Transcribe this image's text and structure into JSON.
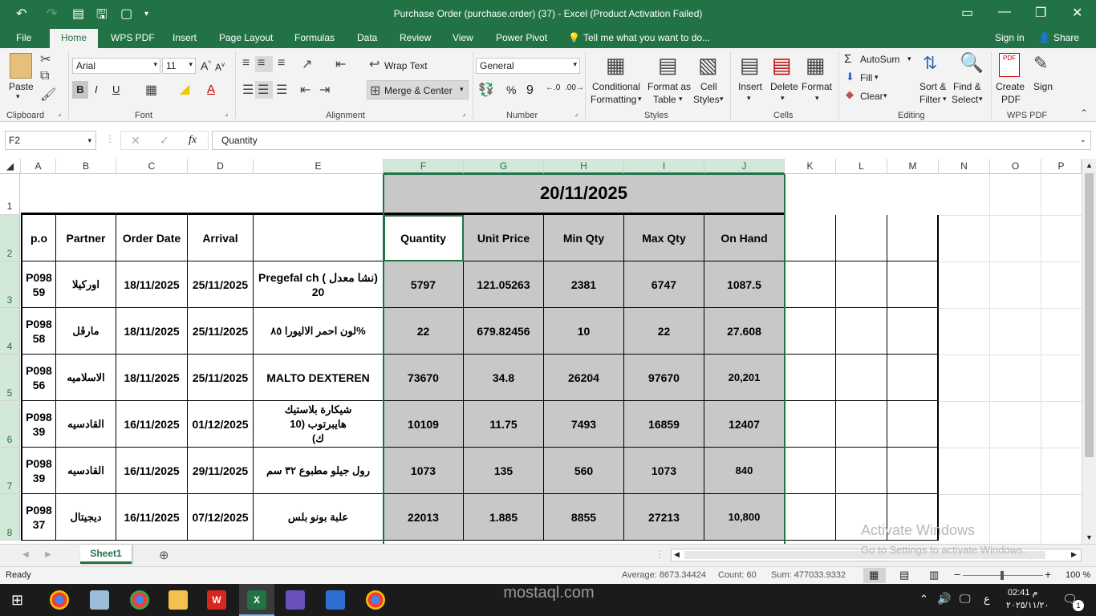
{
  "window": {
    "title": "Purchase Order (purchase.order) (37) - Excel (Product Activation Failed)"
  },
  "tabs": [
    "File",
    "Home",
    "WPS PDF",
    "Insert",
    "Page Layout",
    "Formulas",
    "Data",
    "Review",
    "View",
    "Power Pivot"
  ],
  "tell_me": "Tell me what you want to do...",
  "sign_in": "Sign in",
  "share": "Share",
  "ribbon": {
    "paste": "Paste",
    "font_name": "Arial",
    "font_size": "11",
    "wrap_text": "Wrap Text",
    "merge_center": "Merge & Center",
    "number_format": "General",
    "cond_format_1": "Conditional",
    "cond_format_2": "Formatting",
    "format_table_1": "Format as",
    "format_table_2": "Table",
    "cell_styles_1": "Cell",
    "cell_styles_2": "Styles",
    "insert": "Insert",
    "delete": "Delete",
    "format": "Format",
    "autosum": "AutoSum",
    "fill": "Fill",
    "clear": "Clear",
    "sort_1": "Sort &",
    "sort_2": "Filter",
    "find_1": "Find &",
    "find_2": "Select",
    "create_pdf_1": "Create",
    "create_pdf_2": "PDF",
    "sign": "Sign",
    "groups": {
      "clipboard": "Clipboard",
      "font": "Font",
      "alignment": "Alignment",
      "number": "Number",
      "styles": "Styles",
      "cells": "Cells",
      "editing": "Editing",
      "wps_pdf": "WPS PDF"
    }
  },
  "formula_bar": {
    "name_box": "F2",
    "fx": "fx",
    "content": "Quantity"
  },
  "columns": [
    "A",
    "B",
    "C",
    "D",
    "E",
    "F",
    "G",
    "H",
    "I",
    "J",
    "K",
    "L",
    "M",
    "N",
    "O",
    "P"
  ],
  "rows": [
    "1",
    "2",
    "3",
    "4",
    "5",
    "6",
    "7",
    "8"
  ],
  "sheet": {
    "date": "20/11/2025",
    "headers": [
      "p.o",
      "Partner",
      "Order Date",
      "Arrival",
      "",
      "Quantity",
      "Unit Price",
      "Min Qty",
      "Max Qty",
      "On Hand"
    ],
    "data": [
      [
        "P098 59",
        "اوركيلا",
        "18/11/2025",
        "25/11/2025",
        "Pregefal ch ( نشا معدل) 20",
        "5797",
        "121.05263",
        "2381",
        "6747",
        "1087.5"
      ],
      [
        "P098 58",
        "مارڤل",
        "18/11/2025",
        "25/11/2025",
        "لون احمر الاليورا ٨٥%",
        "22",
        "679.82456",
        "10",
        "22",
        "27.608"
      ],
      [
        "P098 56",
        "الاسلاميه",
        "18/11/2025",
        "25/11/2025",
        "MALTO DEXTEREN",
        "73670",
        "34.8",
        "26204",
        "97670",
        "20,201"
      ],
      [
        "P098 39",
        "القادسيه",
        "16/11/2025",
        "01/12/2025",
        "شيكارة بلاستيك هايبرتوب (10 ك)",
        "10109",
        "11.75",
        "7493",
        "16859",
        "12407"
      ],
      [
        "P098 39",
        "القادسيه",
        "16/11/2025",
        "29/11/2025",
        "رول جيلو مطبوع ٣٢ سم",
        "1073",
        "135",
        "560",
        "1073",
        "840"
      ],
      [
        "P098 37",
        "ديجيتال",
        "16/11/2025",
        "07/12/2025",
        "علبة بونو بلس",
        "22013",
        "1.885",
        "8855",
        "27213",
        "10,800"
      ]
    ]
  },
  "sheet_tab": "Sheet1",
  "watermark": {
    "line1": "Activate Windows",
    "line2": "Go to Settings to activate Windows.",
    "site": "mostaql.com"
  },
  "status": {
    "ready": "Ready",
    "average": "Average: 8673.34424",
    "count": "Count: 60",
    "sum": "Sum: 477033.9332",
    "zoom": "100 %"
  },
  "taskbar": {
    "time": "02:41 م",
    "date": "٢٠٢٥/١١/٢٠",
    "lang": "ع",
    "notif_count": "1"
  }
}
